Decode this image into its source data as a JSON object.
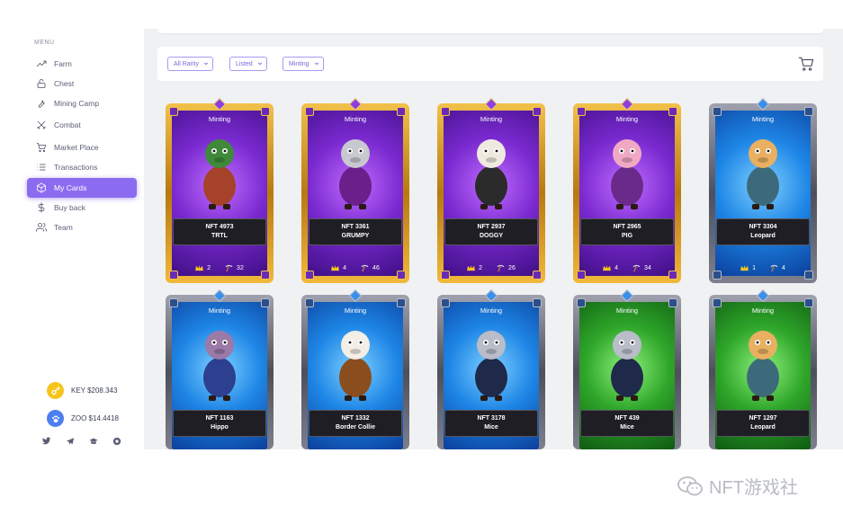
{
  "sidebar": {
    "menu_title": "MENU",
    "items": [
      {
        "label": "Farm",
        "icon": "trending-up-icon",
        "active": false
      },
      {
        "label": "Chest",
        "icon": "lock-icon",
        "active": false
      },
      {
        "label": "Mining Camp",
        "icon": "wrench-icon",
        "active": false
      },
      {
        "label": "Combat",
        "icon": "crossed-swords-icon",
        "active": false
      },
      {
        "label": "Market Place",
        "icon": "cart-icon",
        "active": false
      },
      {
        "label": "Transactions",
        "icon": "list-icon",
        "active": false
      },
      {
        "label": "My Cards",
        "icon": "box-icon",
        "active": true
      },
      {
        "label": "Buy back",
        "icon": "dollar-icon",
        "active": false
      },
      {
        "label": "Team",
        "icon": "users-icon",
        "active": false
      }
    ],
    "tokens": [
      {
        "label": "KEY $208.343",
        "icon": "key-icon",
        "color": "#f5c51d"
      },
      {
        "label": "ZOO $14.4418",
        "icon": "paw-icon",
        "color": "#4d7ff0"
      }
    ],
    "socials": [
      "twitter-icon",
      "telegram-icon",
      "graduation-cap-icon",
      "chrome-icon"
    ]
  },
  "filters": {
    "rarity": "All Rarity",
    "listing": "Listed",
    "state": "Minting"
  },
  "colors": {
    "accent": "#8b6cf0",
    "gold_frame": "#d49a1d",
    "silver_frame": "#6d6f7e",
    "purple_bg": "#6a2ac2",
    "blue_bg": "#1a7fe0",
    "green_bg": "#2f9e2c"
  },
  "cards": [
    {
      "status": "Minting",
      "nft_id": "NFT 4973",
      "name": "TRTL",
      "rarity": "gold",
      "bg": "purple",
      "crowns": "2",
      "picks": "32",
      "character": "turtle"
    },
    {
      "status": "Minting",
      "nft_id": "NFT 3361",
      "name": "GRUMPY",
      "rarity": "gold",
      "bg": "purple",
      "crowns": "4",
      "picks": "46",
      "character": "cat"
    },
    {
      "status": "Minting",
      "nft_id": "NFT 2937",
      "name": "DOGGY",
      "rarity": "gold",
      "bg": "purple",
      "crowns": "2",
      "picks": "26",
      "character": "dog"
    },
    {
      "status": "Minting",
      "nft_id": "NFT 2965",
      "name": "PIG",
      "rarity": "gold",
      "bg": "purple",
      "crowns": "4",
      "picks": "34",
      "character": "pig"
    },
    {
      "status": "Minting",
      "nft_id": "NFT 3304",
      "name": "Leopard",
      "rarity": "silver",
      "bg": "blue",
      "crowns": "1",
      "picks": "4",
      "character": "leopard"
    },
    {
      "status": "Minting",
      "nft_id": "NFT 1163",
      "name": "Hippo",
      "rarity": "silver",
      "bg": "blue",
      "character": "hippo"
    },
    {
      "status": "Minting",
      "nft_id": "NFT 1332",
      "name": "Border Collie",
      "rarity": "silver",
      "bg": "blue",
      "character": "collie"
    },
    {
      "status": "Minting",
      "nft_id": "NFT 3178",
      "name": "Mice",
      "rarity": "silver",
      "bg": "blue",
      "character": "mouse"
    },
    {
      "status": "Minting",
      "nft_id": "NFT 439",
      "name": "Mice",
      "rarity": "silver",
      "bg": "green",
      "character": "mouse"
    },
    {
      "status": "Minting",
      "nft_id": "NFT 1297",
      "name": "Leopard",
      "rarity": "silver",
      "bg": "green",
      "character": "leopard"
    }
  ],
  "watermark": "NFT游戏社"
}
